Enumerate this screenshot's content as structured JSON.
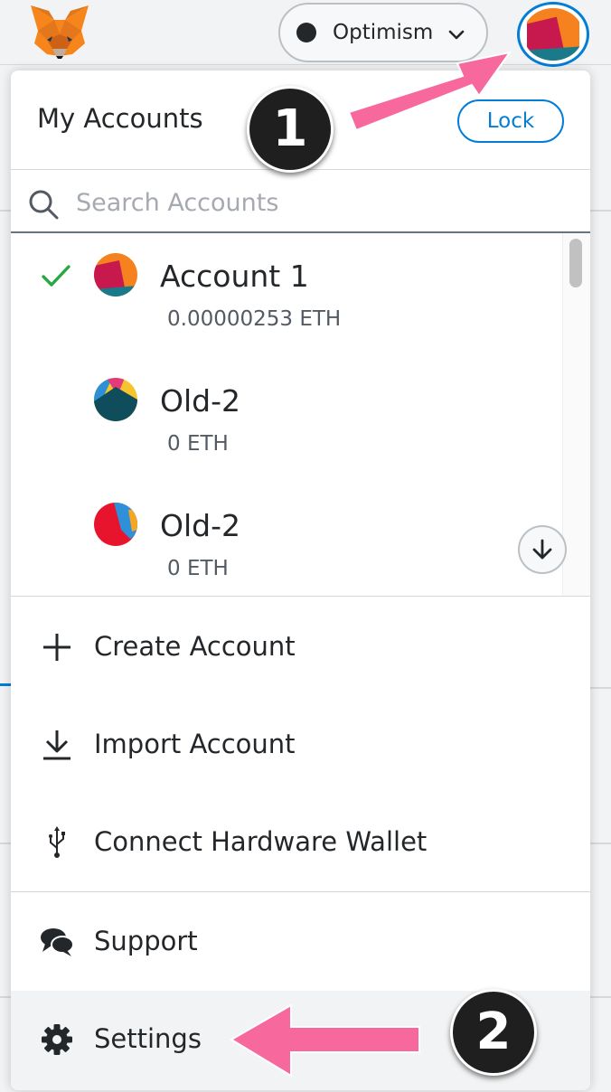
{
  "header": {
    "network": {
      "label": "Optimism",
      "dot_color": "#24272a"
    },
    "logo_icon": "metamask-fox-icon",
    "account_avatar_icon": "account-identicon"
  },
  "menu": {
    "title": "My Accounts",
    "lock_label": "Lock",
    "search": {
      "placeholder": "Search Accounts",
      "value": ""
    },
    "accounts": [
      {
        "name": "Account 1",
        "balance": "0.00000253 ETH",
        "selected": true
      },
      {
        "name": "Old-2",
        "balance": "0 ETH",
        "selected": false
      },
      {
        "name": "Old-2",
        "balance": "0 ETH",
        "selected": false
      }
    ],
    "actions": [
      {
        "label": "Create Account",
        "icon": "plus-icon"
      },
      {
        "label": "Import Account",
        "icon": "download-icon"
      },
      {
        "label": "Connect Hardware Wallet",
        "icon": "usb-icon"
      }
    ],
    "support_label": "Support",
    "settings_label": "Settings"
  },
  "annotations": {
    "step1": "1",
    "step2": "2",
    "arrow_color": "#f7699d"
  },
  "colors": {
    "accent": "#037dd6",
    "success": "#28a745"
  }
}
